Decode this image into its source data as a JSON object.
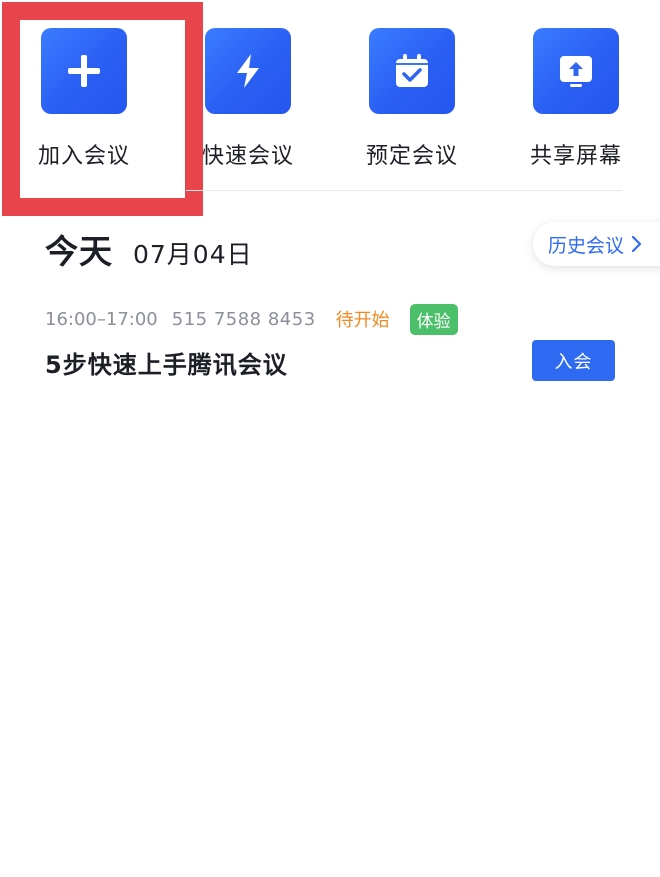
{
  "quick_actions": [
    {
      "label": "加入会议",
      "icon": "plus-icon"
    },
    {
      "label": "快速会议",
      "icon": "lightning-icon"
    },
    {
      "label": "预定会议",
      "icon": "calendar-check-icon"
    },
    {
      "label": "共享屏幕",
      "icon": "screen-share-icon"
    }
  ],
  "day": {
    "title": "今天",
    "date": "07月04日"
  },
  "history_button": {
    "label": "历史会议"
  },
  "meeting": {
    "time": "16:00–17:00",
    "id": "515 7588 8453",
    "status": "待开始",
    "tag": "体验",
    "title": "5步快速上手腾讯会议",
    "join_label": "入会"
  },
  "colors": {
    "accent": "#2f6bf2",
    "highlight": "#e8444c",
    "status_pending": "#f08a24",
    "tag_green": "#4cbf6a"
  }
}
